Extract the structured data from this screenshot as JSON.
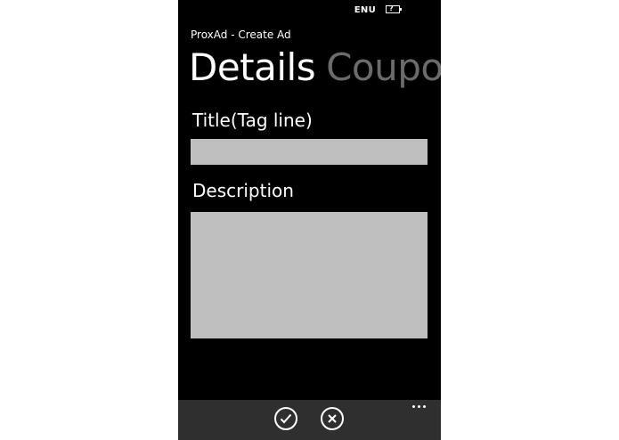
{
  "status_bar": {
    "language": "ENU",
    "battery_icon": "battery-unknown-icon",
    "battery_glyph": "?"
  },
  "app": {
    "title": "ProxAd - Create Ad"
  },
  "pivot": {
    "tabs": [
      {
        "label": "Details",
        "active": true
      },
      {
        "label": "Coupon",
        "active": false
      }
    ]
  },
  "form": {
    "title_label": "Title(Tag line)",
    "title_value": "",
    "description_label": "Description",
    "description_value": ""
  },
  "app_bar": {
    "buttons": [
      {
        "icon": "check-icon"
      },
      {
        "icon": "cancel-icon"
      }
    ],
    "more_icon": "ellipsis-icon",
    "background": "#2f2f2f"
  },
  "colors": {
    "background": "#000000",
    "textbox": "#bfbfbf",
    "inactive_tab": "#6b6b6b"
  }
}
